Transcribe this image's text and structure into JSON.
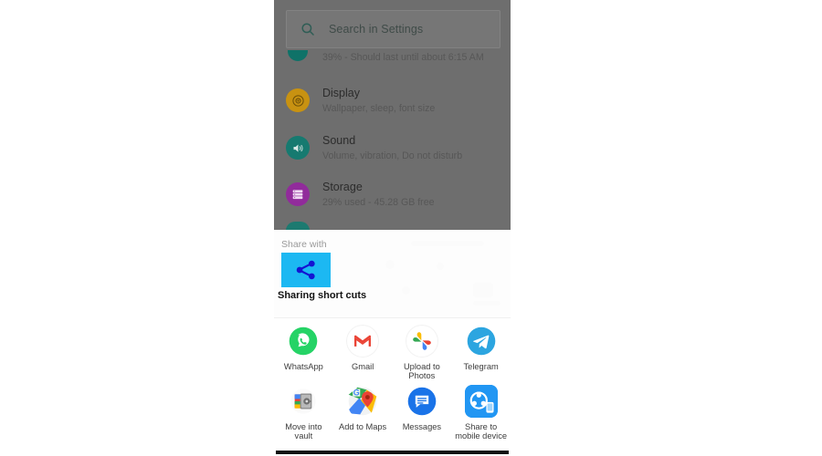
{
  "search": {
    "placeholder": "Search in Settings",
    "icon": "search-icon"
  },
  "settings": {
    "items": [
      {
        "icon": "battery-icon",
        "icon_color": "#0f7268",
        "title": "",
        "subtitle": "39% - Should last until about 6:15 AM"
      },
      {
        "icon": "brightness-icon",
        "icon_color": "#c89211",
        "title": "Display",
        "subtitle": "Wallpaper, sleep, font size"
      },
      {
        "icon": "volume-icon",
        "icon_color": "#167a70",
        "title": "Sound",
        "subtitle": "Volume, vibration, Do not disturb"
      },
      {
        "icon": "storage-icon",
        "icon_color": "#912b9b",
        "title": "Storage",
        "subtitle": "29% used - 45.28 GB free"
      }
    ]
  },
  "share_sheet": {
    "header_label": "Share with",
    "shortcut": {
      "label": "Sharing short cuts",
      "icon": "share-nodes-icon",
      "tile_color": "#1cb8f2",
      "glyph_color": "#1414d2"
    },
    "rows": [
      {
        "apps": [
          {
            "label": "WhatsApp",
            "icon": "whatsapp-icon",
            "color": "#25d366"
          },
          {
            "label": "Gmail",
            "icon": "gmail-icon",
            "color": "#ea4335"
          },
          {
            "label": "Upload to Photos",
            "icon": "google-photos-icon",
            "color": "#4285f4"
          },
          {
            "label": "Telegram",
            "icon": "telegram-icon",
            "color": "#2ca5e0"
          }
        ]
      },
      {
        "apps": [
          {
            "label": "Move into vault",
            "icon": "vault-icon",
            "color": "#8a8a8a"
          },
          {
            "label": "Add to Maps",
            "icon": "google-maps-icon",
            "color": "#34a853"
          },
          {
            "label": "Messages",
            "icon": "messages-icon",
            "color": "#1a73e8"
          },
          {
            "label": "Share to mobile device",
            "icon": "shareit-icon",
            "color": "#2196f3"
          }
        ]
      }
    ]
  },
  "navbar": {
    "label": "navigation-bar"
  }
}
